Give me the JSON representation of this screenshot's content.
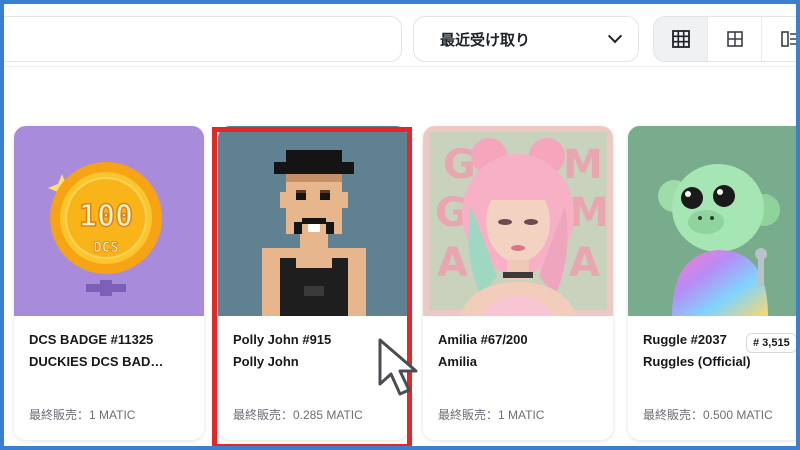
{
  "toolbar": {
    "search": {
      "placeholder": ""
    },
    "sort": {
      "label": "最近受け取り"
    },
    "views": [
      "grid-large",
      "grid-small",
      "list"
    ]
  },
  "cards": [
    {
      "title": "DCS BADGE #11325",
      "collection": "DUCKIES DCS BAD…",
      "price": "最終販売：1 MATIC",
      "coin_text": "100",
      "coin_sub": "DCS"
    },
    {
      "title": "Polly John #915",
      "collection": "Polly John",
      "price": "最終販売：0.285 MATIC"
    },
    {
      "title": "Amilia #67/200",
      "collection": "Amilia",
      "price": "最終販売：1 MATIC",
      "art_text": [
        "G",
        "M",
        "G",
        "M",
        "A",
        "A"
      ]
    },
    {
      "title": "Ruggle #2037",
      "collection": "Ruggles (Official)",
      "price": "最終販売：0.500 MATIC",
      "rank": "# 3,515"
    }
  ],
  "colors": {
    "frame": "#3b7fd0",
    "highlight": "#e32626",
    "badge_bg": "#a98bdc",
    "pixel_bg": "#5f8191",
    "amilia_bg": "#eec9c4",
    "ruggle_bg": "#6fa383"
  }
}
